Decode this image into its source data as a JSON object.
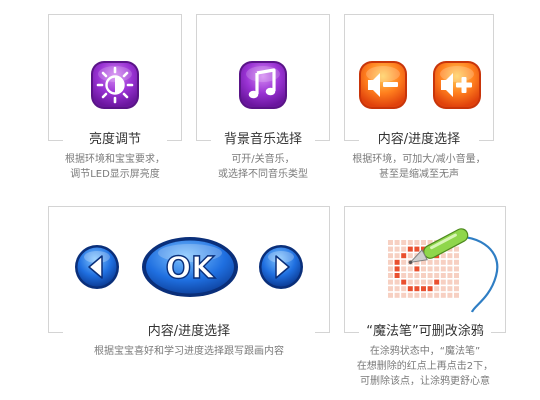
{
  "cards": [
    {
      "title": "亮度调节",
      "desc": [
        "根据环境和宝宝要求，",
        "调节LED显示屏亮度"
      ],
      "icon": "brightness-icon"
    },
    {
      "title": "背景音乐选择",
      "desc": [
        "可开/关音乐，",
        "或选择不同音乐类型"
      ],
      "icon": "music-note-icon"
    },
    {
      "title": "内容/进度选择",
      "desc": [
        "根据环境，可加大/减小音量，",
        "甚至是缩减至无声"
      ],
      "icon": "volume-icons"
    },
    {
      "title": "内容/进度选择",
      "desc": [
        "根据宝宝喜好和学习进度选择跟写跟画内容"
      ],
      "icon": "navigation-buttons"
    },
    {
      "title": "“魔法笔”可删改涂鸦",
      "desc": [
        "在涂鸦状态中，“魔法笔”",
        "在想删除的红点上再点击2下，",
        "可删除该点，让涂鸦更舒心意"
      ],
      "icon": "magic-pen-illustration"
    }
  ],
  "buttons": {
    "ok_label": "OK"
  }
}
